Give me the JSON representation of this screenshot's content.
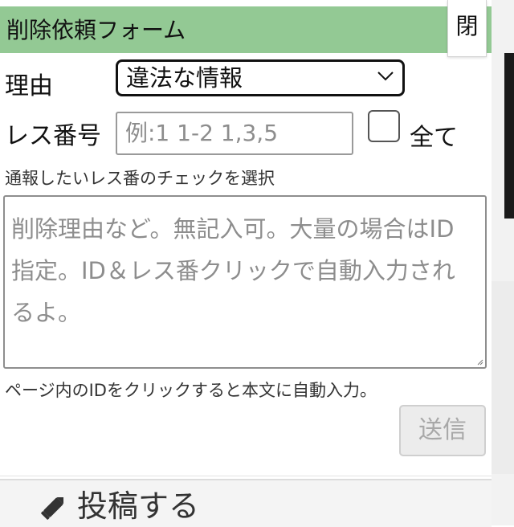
{
  "header": {
    "title": "削除依頼フォーム",
    "close_label": "閉"
  },
  "form": {
    "reason_label": "理由",
    "reason_value": "違法な情報",
    "res_number_label": "レス番号",
    "res_number_placeholder": "例:1 1-2 1,3,5",
    "all_label": "全て",
    "hint_select": "通報したいレス番のチェックを選択",
    "comment_placeholder": "削除理由など。無記入可。大量の場合はID指定。ID＆レス番クリックで自動入力されるよ。",
    "hint_id": "ページ内のIDをクリックすると本文に自動入力。",
    "send_label": "送信"
  },
  "footer": {
    "post_label": "投稿する"
  },
  "icons": {
    "select_arrow": "chevron-down-icon",
    "post": "pencil-icon"
  },
  "colors": {
    "header_bg": "#93c994",
    "send_disabled_text": "#a8a8a8"
  }
}
